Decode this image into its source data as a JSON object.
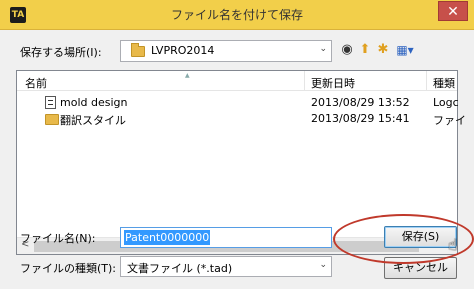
{
  "window": {
    "title": "ファイル名を付けて保存",
    "app_icon_text": "TA",
    "close_glyph": "✕"
  },
  "look_in": {
    "label": "保存する場所(I):",
    "value": "LVPRO2014",
    "arrow": "⌄"
  },
  "toolbar": {
    "back_glyph": "◉",
    "up_glyph": "⬆",
    "new_folder_glyph": "✱",
    "view_glyph": "▦▾"
  },
  "file_list": {
    "columns": [
      "名前",
      "更新日時",
      "種類"
    ],
    "rows": [
      {
        "name": "mold design",
        "modified": "2013/08/29 13:52",
        "type": "Logc",
        "icon": "document-icon"
      },
      {
        "name": "翻訳スタイル",
        "modified": "2013/08/29 15:41",
        "type": "ファイ",
        "icon": "folder-icon"
      }
    ],
    "scroll_left": "<",
    "scroll_right": ">"
  },
  "file_name": {
    "label": "ファイル名(N):",
    "value": "Patent0000000"
  },
  "file_type": {
    "label": "ファイルの種類(T):",
    "value": "文書ファイル (*.tad)",
    "arrow": "⌄"
  },
  "buttons": {
    "save": "保存(S)",
    "cancel": "キャンセル"
  },
  "colors": {
    "titlebar": "#f2cf4a",
    "highlight": "#c0392b",
    "selection": "#3399ff"
  }
}
